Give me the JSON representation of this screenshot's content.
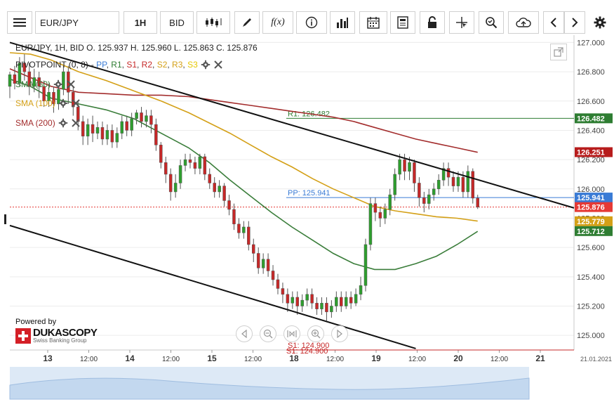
{
  "toolbar": {
    "symbol": "EUR/JPY",
    "timeframe": "1H",
    "price_side": "BID",
    "fx_label": "f(x)"
  },
  "legend": {
    "ohlc_line": "EUR/JPY, 1H, BID   O. 125.937 H. 125.960 L. 125.863 C. 125.876",
    "pivot_title": "PIVOTPOINT (0, 8)",
    "pivot_items": [
      {
        "label": "PP",
        "color": "#3a7bd5"
      },
      {
        "label": "R1",
        "color": "#2e7d32"
      },
      {
        "label": "S1",
        "color": "#c62828"
      },
      {
        "label": "R2",
        "color": "#c62828"
      },
      {
        "label": "S2",
        "color": "#d4a017"
      },
      {
        "label": "R3",
        "color": "#d4a017"
      },
      {
        "label": "S3",
        "color": "#e6c700"
      }
    ],
    "sma50": "SMA (50)",
    "sma100": "SMA (100)",
    "sma200": "SMA (200)"
  },
  "branding": {
    "powered_by": "Powered by",
    "logo_name": "DUKASCOPY",
    "logo_sub": "Swiss Banking Group"
  },
  "chart_data": {
    "type": "candlestick",
    "symbol": "EUR/JPY",
    "timeframe": "1H",
    "y_ticks": [
      127.0,
      126.8,
      126.6,
      126.4,
      126.2,
      126.0,
      125.8,
      125.6,
      125.4,
      125.2,
      125.0
    ],
    "ylim": [
      124.9,
      127.05
    ],
    "x_ticks": [
      "13",
      "12:00",
      "14",
      "12:00",
      "15",
      "12:00",
      "18",
      "12:00",
      "19",
      "12:00",
      "20",
      "12:00",
      "21"
    ],
    "x_edge_label": "21.01.2021",
    "ohlc": {
      "open": 125.937,
      "high": 125.96,
      "low": 125.863,
      "close": 125.876
    },
    "pivot_lines": [
      {
        "name": "R1",
        "label": "R1: 126.482",
        "value": 126.482,
        "color": "#2e7d32"
      },
      {
        "name": "PP",
        "label": "PP: 125.941",
        "value": 125.941,
        "color": "#3a7bd5"
      },
      {
        "name": "S1",
        "label": "S1: 124.900",
        "value": 124.9,
        "color": "#c62828"
      }
    ],
    "price_labels": [
      {
        "value": 126.482,
        "text": "126.482",
        "color": "#2e7d32"
      },
      {
        "value": 126.251,
        "text": "126.251",
        "color": "#b71c1c"
      },
      {
        "value": 125.941,
        "text": "125.941",
        "color": "#3a7bd5"
      },
      {
        "value": 125.876,
        "text": "125.876",
        "color": "#e53935"
      },
      {
        "value": 125.779,
        "text": "125.779",
        "color": "#d4a017"
      },
      {
        "value": 125.712,
        "text": "125.712",
        "color": "#2e7d32"
      }
    ],
    "current_price": 125.876,
    "series": [
      {
        "name": "SMA (200)",
        "color": "#a32d2d",
        "points": [
          [
            0,
            126.82
          ],
          [
            30,
            126.76
          ],
          [
            60,
            126.7
          ],
          [
            100,
            126.66
          ],
          [
            140,
            126.65
          ],
          [
            180,
            126.64
          ],
          [
            220,
            126.64
          ],
          [
            260,
            126.63
          ],
          [
            290,
            126.61
          ],
          [
            320,
            126.59
          ],
          [
            350,
            126.57
          ],
          [
            380,
            126.55
          ],
          [
            410,
            126.53
          ],
          [
            440,
            126.51
          ],
          [
            470,
            126.49
          ],
          [
            500,
            126.46
          ],
          [
            530,
            126.42
          ],
          [
            560,
            126.38
          ],
          [
            590,
            126.34
          ],
          [
            620,
            126.31
          ],
          [
            650,
            126.28
          ],
          [
            680,
            126.25
          ]
        ]
      },
      {
        "name": "SMA (100)",
        "color": "#d4a017",
        "points": [
          [
            0,
            126.93
          ],
          [
            30,
            126.92
          ],
          [
            60,
            126.88
          ],
          [
            100,
            126.8
          ],
          [
            140,
            126.74
          ],
          [
            180,
            126.67
          ],
          [
            220,
            126.6
          ],
          [
            260,
            126.52
          ],
          [
            290,
            126.45
          ],
          [
            320,
            126.38
          ],
          [
            350,
            126.3
          ],
          [
            380,
            126.22
          ],
          [
            410,
            126.15
          ],
          [
            440,
            126.07
          ],
          [
            470,
            126.0
          ],
          [
            500,
            125.94
          ],
          [
            530,
            125.88
          ],
          [
            560,
            125.85
          ],
          [
            590,
            125.83
          ],
          [
            620,
            125.81
          ],
          [
            650,
            125.8
          ],
          [
            680,
            125.78
          ]
        ]
      },
      {
        "name": "SMA (50)",
        "color": "#3a7d3a",
        "points": [
          [
            0,
            126.75
          ],
          [
            30,
            126.7
          ],
          [
            60,
            126.62
          ],
          [
            100,
            126.58
          ],
          [
            140,
            126.54
          ],
          [
            180,
            126.48
          ],
          [
            220,
            126.38
          ],
          [
            260,
            126.28
          ],
          [
            290,
            126.18
          ],
          [
            320,
            126.06
          ],
          [
            350,
            125.95
          ],
          [
            380,
            125.84
          ],
          [
            410,
            125.74
          ],
          [
            440,
            125.65
          ],
          [
            470,
            125.56
          ],
          [
            500,
            125.49
          ],
          [
            530,
            125.45
          ],
          [
            560,
            125.45
          ],
          [
            590,
            125.49
          ],
          [
            620,
            125.54
          ],
          [
            650,
            125.62
          ],
          [
            680,
            125.71
          ]
        ]
      }
    ],
    "trendlines": [
      {
        "from": [
          0,
          127.0
        ],
        "to": [
          820,
          125.87
        ],
        "color": "#111111"
      },
      {
        "from": [
          0,
          125.75
        ],
        "to": [
          590,
          124.91
        ],
        "color": "#111111"
      }
    ],
    "candles": [
      [
        126.7,
        126.78,
        126.8,
        126.62
      ],
      [
        126.78,
        126.72,
        126.84,
        126.68
      ],
      [
        126.72,
        126.86,
        126.9,
        126.7
      ],
      [
        126.86,
        126.8,
        126.92,
        126.74
      ],
      [
        126.8,
        126.7,
        126.86,
        126.64
      ],
      [
        126.7,
        126.76,
        126.82,
        126.66
      ],
      [
        126.76,
        126.7,
        126.8,
        126.62
      ],
      [
        126.7,
        126.6,
        126.74,
        126.56
      ],
      [
        126.6,
        126.66,
        126.72,
        126.56
      ],
      [
        126.66,
        126.58,
        126.7,
        126.52
      ],
      [
        126.58,
        126.68,
        126.74,
        126.54
      ],
      [
        126.68,
        126.8,
        126.84,
        126.64
      ],
      [
        126.8,
        126.66,
        126.84,
        126.58
      ],
      [
        126.66,
        126.56,
        126.7,
        126.5
      ],
      [
        126.56,
        126.46,
        126.6,
        126.4
      ],
      [
        126.46,
        126.36,
        126.5,
        126.3
      ],
      [
        126.36,
        126.44,
        126.48,
        126.3
      ],
      [
        126.44,
        126.38,
        126.5,
        126.32
      ],
      [
        126.38,
        126.42,
        126.46,
        126.34
      ],
      [
        126.42,
        126.34,
        126.46,
        126.3
      ],
      [
        126.34,
        126.4,
        126.44,
        126.3
      ],
      [
        126.4,
        126.32,
        126.44,
        126.28
      ],
      [
        126.32,
        126.38,
        126.42,
        126.28
      ],
      [
        126.38,
        126.46,
        126.5,
        126.34
      ],
      [
        126.46,
        126.4,
        126.5,
        126.36
      ],
      [
        126.4,
        126.48,
        126.52,
        126.36
      ],
      [
        126.48,
        126.52,
        126.54,
        126.44
      ],
      [
        126.52,
        126.46,
        126.56,
        126.42
      ],
      [
        126.46,
        126.5,
        126.54,
        126.42
      ],
      [
        126.5,
        126.44,
        126.54,
        126.38
      ],
      [
        126.44,
        126.3,
        126.48,
        126.26
      ],
      [
        126.3,
        126.18,
        126.32,
        126.14
      ],
      [
        126.18,
        126.1,
        126.22,
        126.04
      ],
      [
        126.1,
        125.98,
        126.14,
        125.92
      ],
      [
        125.98,
        126.04,
        126.1,
        125.94
      ],
      [
        126.04,
        126.16,
        126.2,
        126.0
      ],
      [
        126.16,
        126.2,
        126.24,
        126.12
      ],
      [
        126.2,
        126.18,
        126.24,
        126.14
      ],
      [
        126.18,
        126.14,
        126.22,
        126.1
      ],
      [
        126.14,
        126.22,
        126.24,
        126.1
      ],
      [
        126.22,
        126.1,
        126.24,
        126.06
      ],
      [
        126.1,
        126.04,
        126.14,
        126.0
      ],
      [
        126.04,
        125.98,
        126.08,
        125.94
      ],
      [
        125.98,
        126.02,
        126.06,
        125.94
      ],
      [
        126.02,
        125.92,
        126.04,
        125.88
      ],
      [
        125.92,
        125.86,
        125.96,
        125.82
      ],
      [
        125.86,
        125.76,
        125.9,
        125.72
      ],
      [
        125.76,
        125.7,
        125.8,
        125.66
      ],
      [
        125.7,
        125.74,
        125.78,
        125.66
      ],
      [
        125.74,
        125.62,
        125.78,
        125.58
      ],
      [
        125.62,
        125.56,
        125.66,
        125.5
      ],
      [
        125.56,
        125.46,
        125.6,
        125.42
      ],
      [
        125.46,
        125.52,
        125.56,
        125.42
      ],
      [
        125.52,
        125.44,
        125.56,
        125.4
      ],
      [
        125.44,
        125.38,
        125.48,
        125.34
      ],
      [
        125.38,
        125.32,
        125.42,
        125.28
      ],
      [
        125.32,
        125.28,
        125.36,
        125.22
      ],
      [
        125.28,
        125.22,
        125.32,
        125.16
      ],
      [
        125.22,
        125.26,
        125.3,
        125.18
      ],
      [
        125.26,
        125.2,
        125.3,
        125.14
      ],
      [
        125.2,
        125.24,
        125.28,
        125.16
      ],
      [
        125.24,
        125.28,
        125.32,
        125.2
      ],
      [
        125.28,
        125.22,
        125.32,
        125.18
      ],
      [
        125.22,
        125.18,
        125.26,
        125.14
      ],
      [
        125.18,
        125.22,
        125.26,
        125.14
      ],
      [
        125.22,
        125.16,
        125.26,
        125.1
      ],
      [
        125.16,
        125.2,
        125.24,
        125.12
      ],
      [
        125.2,
        125.26,
        125.3,
        125.16
      ],
      [
        125.26,
        125.2,
        125.3,
        125.16
      ],
      [
        125.2,
        125.26,
        125.3,
        125.18
      ],
      [
        125.26,
        125.22,
        125.3,
        125.18
      ],
      [
        125.22,
        125.28,
        125.32,
        125.2
      ],
      [
        125.28,
        125.34,
        125.4,
        125.24
      ],
      [
        125.34,
        125.62,
        125.66,
        125.3
      ],
      [
        125.62,
        125.9,
        125.94,
        125.58
      ],
      [
        125.9,
        125.84,
        125.94,
        125.78
      ],
      [
        125.84,
        125.8,
        125.88,
        125.74
      ],
      [
        125.8,
        125.86,
        125.9,
        125.76
      ],
      [
        125.86,
        125.96,
        126.0,
        125.82
      ],
      [
        125.96,
        126.1,
        126.14,
        125.92
      ],
      [
        126.1,
        126.2,
        126.24,
        126.06
      ],
      [
        126.2,
        126.12,
        126.24,
        126.06
      ],
      [
        126.12,
        126.18,
        126.22,
        126.06
      ],
      [
        126.18,
        126.04,
        126.2,
        125.98
      ],
      [
        126.04,
        125.94,
        126.08,
        125.88
      ],
      [
        125.94,
        125.9,
        125.98,
        125.84
      ],
      [
        125.9,
        125.96,
        126.0,
        125.86
      ],
      [
        125.96,
        126.0,
        126.04,
        125.92
      ],
      [
        126.0,
        126.06,
        126.1,
        125.96
      ],
      [
        126.06,
        126.14,
        126.18,
        126.02
      ],
      [
        126.14,
        126.08,
        126.18,
        126.02
      ],
      [
        126.08,
        126.02,
        126.12,
        125.98
      ],
      [
        126.02,
        126.08,
        126.12,
        125.98
      ],
      [
        126.08,
        125.98,
        126.12,
        125.94
      ],
      [
        125.98,
        126.12,
        126.16,
        125.94
      ],
      [
        126.12,
        125.937,
        126.14,
        125.9
      ],
      [
        125.937,
        125.876,
        125.96,
        125.863
      ]
    ]
  }
}
